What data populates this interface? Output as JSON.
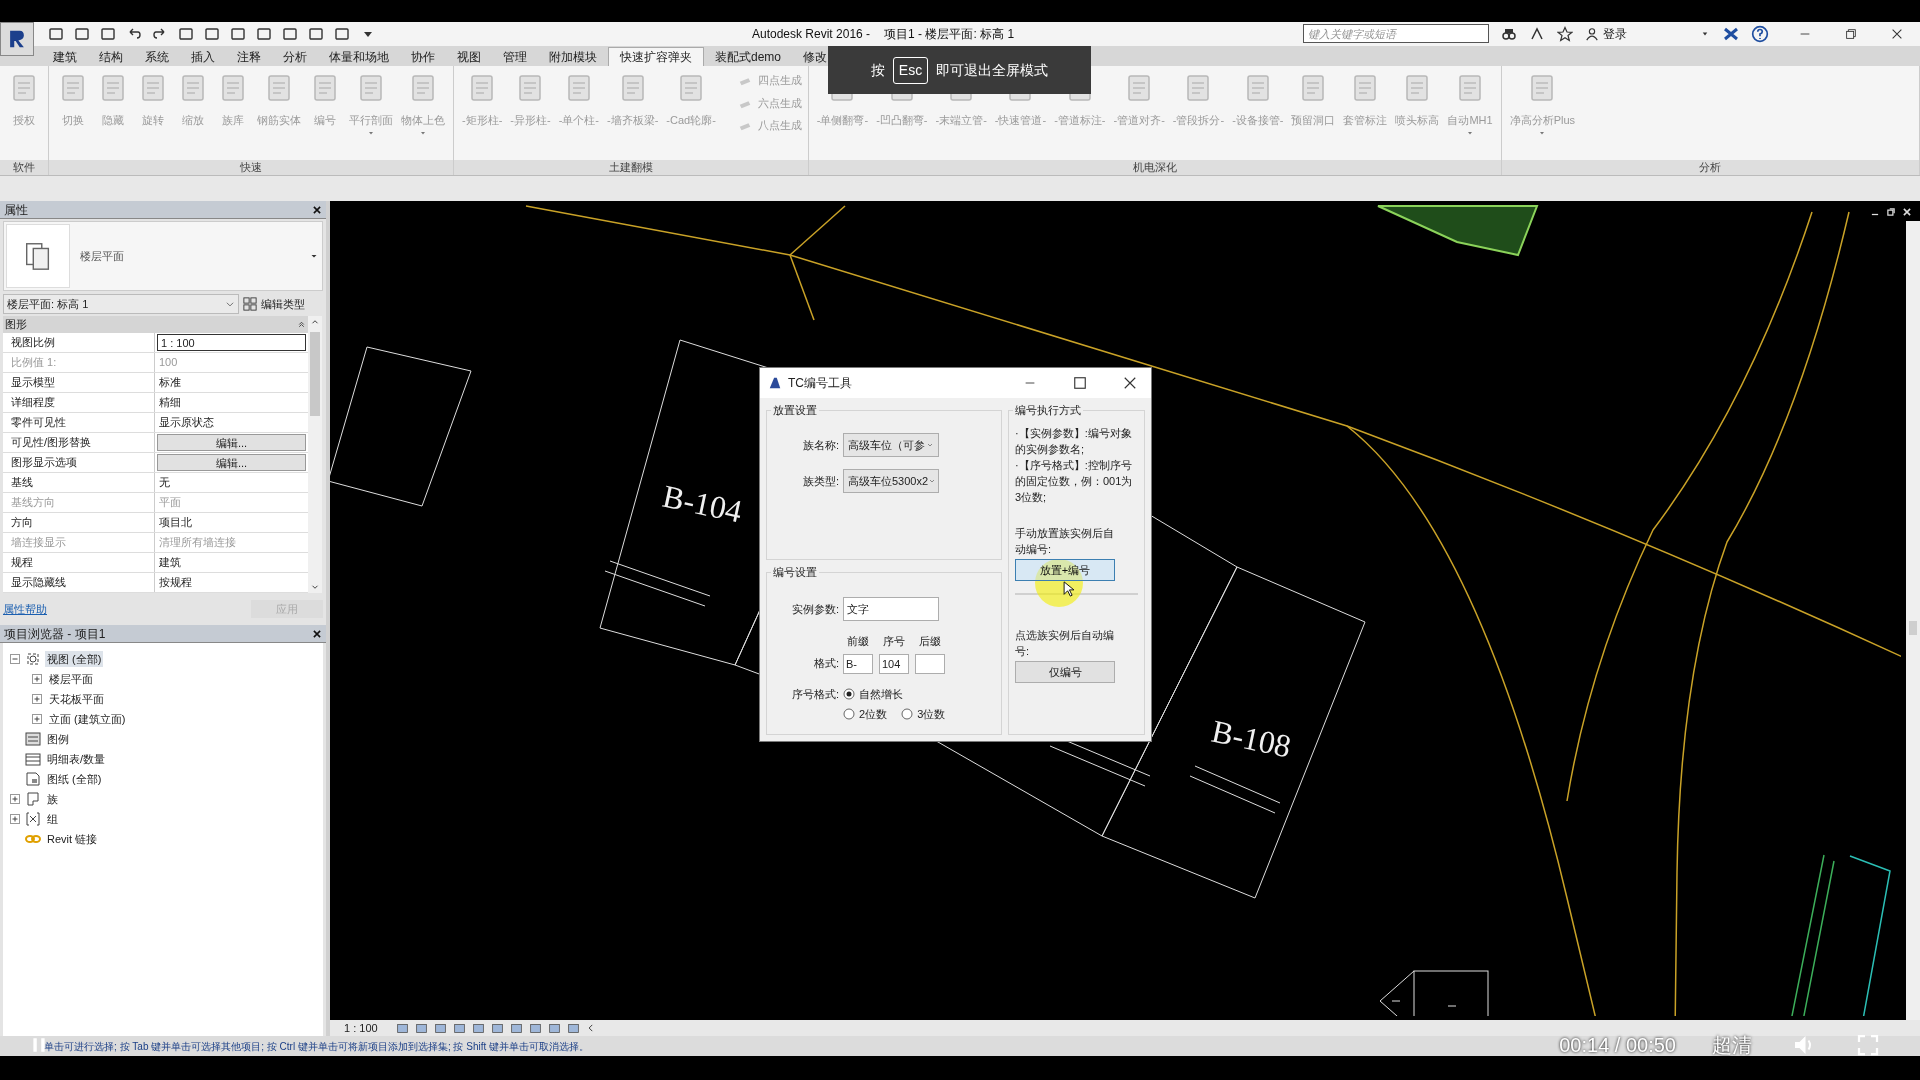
{
  "title_bar": {
    "app_title": "Autodesk Revit 2016 -",
    "doc_title": "项目1 - 楼层平面: 标高 1",
    "search": {
      "placeholder": "键入关键字或短语"
    },
    "sign_in": "登录"
  },
  "ribbon_tabs": [
    {
      "label": "建筑",
      "selected": false
    },
    {
      "label": "结构",
      "selected": false
    },
    {
      "label": "系统",
      "selected": false
    },
    {
      "label": "插入",
      "selected": false
    },
    {
      "label": "注释",
      "selected": false
    },
    {
      "label": "分析",
      "selected": false
    },
    {
      "label": "体量和场地",
      "selected": false
    },
    {
      "label": "协作",
      "selected": false
    },
    {
      "label": "视图",
      "selected": false
    },
    {
      "label": "管理",
      "selected": false
    },
    {
      "label": "附加模块",
      "selected": false
    },
    {
      "label": "快速扩容弹夹",
      "selected": true
    },
    {
      "label": "装配式demo",
      "selected": false
    },
    {
      "label": "修改",
      "selected": false
    }
  ],
  "ribbon_panels": [
    {
      "label": "软件",
      "tools": [
        {
          "label": "授权",
          "kind": "large",
          "has_menu": false
        }
      ]
    },
    {
      "label": "快速",
      "tools": [
        {
          "label": "切换",
          "kind": "large",
          "has_menu": false
        },
        {
          "label": "隐藏",
          "kind": "large",
          "has_menu": false
        },
        {
          "label": "旋转",
          "kind": "large",
          "has_menu": false
        },
        {
          "label": "缩放",
          "kind": "large",
          "has_menu": false
        },
        {
          "label": "族库",
          "kind": "large",
          "has_menu": false
        },
        {
          "label": "钢筋实体",
          "kind": "large",
          "has_menu": false
        },
        {
          "label": "编号",
          "kind": "large",
          "has_menu": false
        },
        {
          "label": "平行剖面",
          "kind": "large",
          "has_menu": true
        },
        {
          "label": "物体上色",
          "kind": "large",
          "has_menu": true
        }
      ]
    },
    {
      "label": "土建翻模",
      "tools": [
        {
          "label": "-矩形柱-",
          "kind": "large",
          "has_menu": false
        },
        {
          "label": "-异形柱-",
          "kind": "large",
          "has_menu": false
        },
        {
          "label": "-单个柱-",
          "kind": "large",
          "has_menu": false
        },
        {
          "label": "-墙齐板梁-",
          "kind": "large",
          "has_menu": false
        },
        {
          "label": "-Cad轮廓-",
          "kind": "large",
          "has_menu": false
        },
        {
          "label": "四点生成",
          "kind": "small"
        },
        {
          "label": "六点生成",
          "kind": "small"
        },
        {
          "label": "八点生成",
          "kind": "small"
        }
      ]
    },
    {
      "label": "机电深化",
      "tools": [
        {
          "label": "-单侧翻弯-",
          "kind": "large",
          "has_menu": false
        },
        {
          "label": "-凹凸翻弯-",
          "kind": "large",
          "has_menu": false
        },
        {
          "label": "-末端立管-",
          "kind": "large",
          "has_menu": false
        },
        {
          "label": "-快速管道-",
          "kind": "large",
          "has_menu": false
        },
        {
          "label": "-管道标注-",
          "kind": "large",
          "has_menu": false
        },
        {
          "label": "-管道对齐-",
          "kind": "large",
          "has_menu": false
        },
        {
          "label": "-管段拆分-",
          "kind": "large",
          "has_menu": false
        },
        {
          "label": "-设备接管-",
          "kind": "large",
          "has_menu": false
        },
        {
          "label": "预留洞口",
          "kind": "large",
          "has_menu": false
        },
        {
          "label": "套管标注",
          "kind": "large",
          "has_menu": false
        },
        {
          "label": "喷头标高",
          "kind": "large",
          "has_menu": false
        },
        {
          "label": "自动MH1",
          "kind": "large",
          "has_menu": true
        }
      ]
    },
    {
      "label": "分析",
      "tools": [
        {
          "label": "净高分析Plus",
          "kind": "large",
          "has_menu": true
        }
      ]
    }
  ],
  "fullscreen_notice": {
    "prefix": "按",
    "key": "Esc",
    "suffix": "即可退出全屏模式"
  },
  "properties": {
    "title": "属性",
    "type_name": "楼层平面",
    "instance_selector": "楼层平面: 标高 1",
    "edit_type": "编辑类型",
    "group": "图形",
    "rows": [
      {
        "label": "视图比例",
        "value": "1 : 100",
        "kind": "input",
        "disabled": false
      },
      {
        "label": "比例值 1:",
        "value": "100",
        "kind": "text",
        "disabled": true
      },
      {
        "label": "显示模型",
        "value": "标准",
        "kind": "text",
        "disabled": false
      },
      {
        "label": "详细程度",
        "value": "精细",
        "kind": "text",
        "disabled": false
      },
      {
        "label": "零件可见性",
        "value": "显示原状态",
        "kind": "text",
        "disabled": false
      },
      {
        "label": "可见性/图形替换",
        "value": "编辑...",
        "kind": "button",
        "disabled": false
      },
      {
        "label": "图形显示选项",
        "value": "编辑...",
        "kind": "button",
        "disabled": false
      },
      {
        "label": "基线",
        "value": "无",
        "kind": "text",
        "disabled": false
      },
      {
        "label": "基线方向",
        "value": "平面",
        "kind": "text",
        "disabled": true
      },
      {
        "label": "方向",
        "value": "项目北",
        "kind": "text",
        "disabled": false
      },
      {
        "label": "墙连接显示",
        "value": "清理所有墙连接",
        "kind": "text",
        "disabled": true
      },
      {
        "label": "规程",
        "value": "建筑",
        "kind": "text",
        "disabled": false
      },
      {
        "label": "显示隐藏线",
        "value": "按规程",
        "kind": "text",
        "disabled": false
      }
    ],
    "help_link": "属性帮助",
    "apply": "应用"
  },
  "project_browser": {
    "title": "项目浏览器 - 项目1",
    "items": [
      {
        "label": "视图 (全部)",
        "kind": "views",
        "expanded": true,
        "selected": true,
        "children": [
          {
            "label": "楼层平面",
            "expanded": false,
            "selected": false
          },
          {
            "label": "天花板平面",
            "expanded": false,
            "selected": false
          },
          {
            "label": "立面 (建筑立面)",
            "expanded": false,
            "selected": false
          }
        ]
      },
      {
        "label": "图例",
        "kind": "legend",
        "selected": false
      },
      {
        "label": "明细表/数量",
        "kind": "schedule",
        "selected": false
      },
      {
        "label": "图纸 (全部)",
        "kind": "sheet",
        "selected": false
      },
      {
        "label": "族",
        "kind": "family",
        "expanded": false,
        "selected": false
      },
      {
        "label": "组",
        "kind": "group",
        "expanded": false,
        "selected": false
      },
      {
        "label": "Revit 链接",
        "kind": "link",
        "selected": false
      }
    ]
  },
  "canvas": {
    "space_tags": [
      "B-104",
      "B-108"
    ]
  },
  "dialog": {
    "title": "TC编号工具",
    "placement": {
      "title": "放置设置",
      "family_name": {
        "label": "族名称:",
        "value": "高级车位（可参"
      },
      "family_type": {
        "label": "族类型:",
        "value": "高级车位5300x2"
      }
    },
    "numbering": {
      "title": "编号设置",
      "instance_param": {
        "label": "实例参数:",
        "value": "文字"
      },
      "format_label": "格式:",
      "format_fields": [
        {
          "header": "前缀",
          "value": "B-"
        },
        {
          "header": "序号",
          "value": "104"
        },
        {
          "header": "后缀"
        }
      ],
      "sequence_label": "序号格式:",
      "sequence_options": [
        {
          "label": "自然增长",
          "selected": true
        },
        {
          "label": "2位数",
          "selected": false
        },
        {
          "label": "3位数",
          "selected": false
        }
      ]
    },
    "execution": {
      "title": "编号执行方式",
      "notes": [
        "·【实例参数】:编号对象的实例参数名;",
        "·【序号格式】:控制序号的固定位数，例：001为3位数;"
      ],
      "actions": [
        {
          "caption": "手动放置族实例后自动编号:",
          "button": "放置+编号",
          "hovered": true
        },
        {
          "caption": "点选族实例后自动编号:",
          "button": "仅编号",
          "hovered": false
        }
      ]
    }
  },
  "view_bar": {
    "scale": "1 : 100"
  },
  "status_bar": "单击可进行选择; 按 Tab 键并单击可选择其他项目; 按 Ctrl 键并单击可将新项目添加到选择集; 按 Shift 键并单击可取消选择。",
  "video_player": {
    "time": "00:14 / 00:50",
    "quality": "超清"
  }
}
